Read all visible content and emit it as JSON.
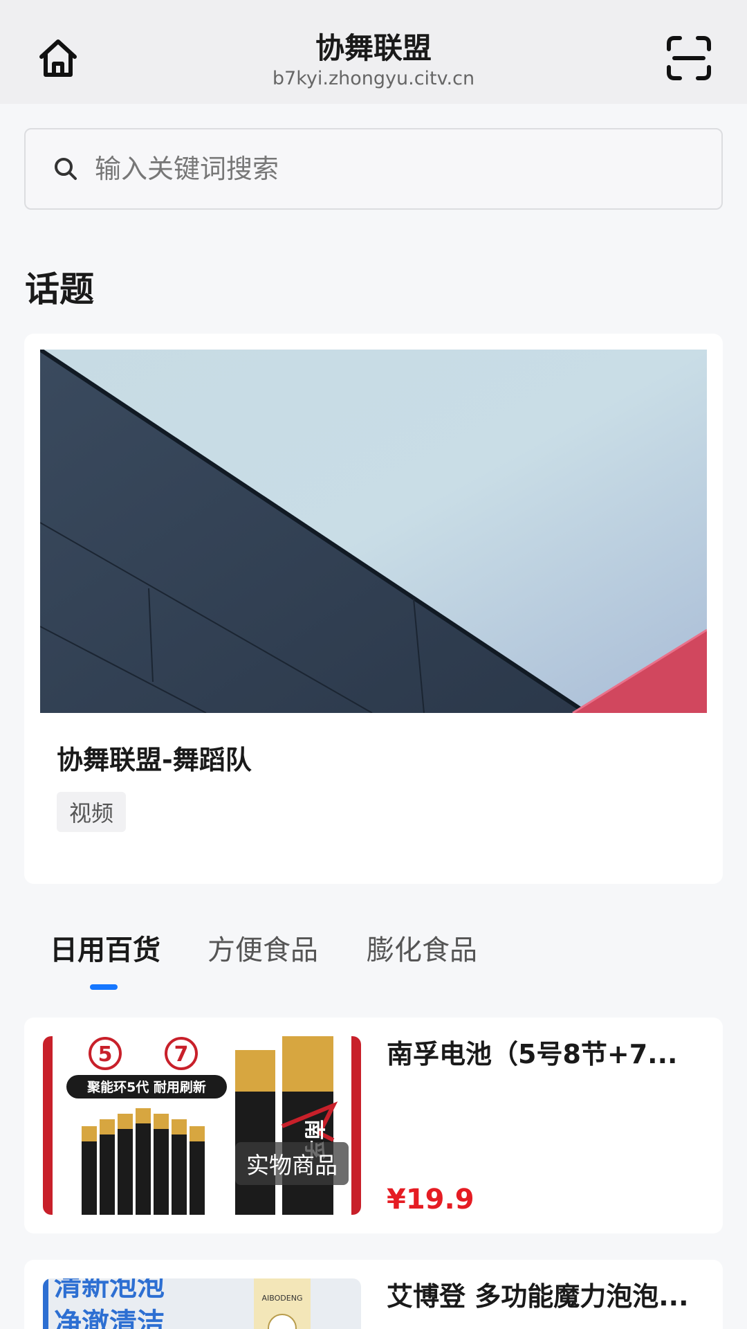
{
  "header": {
    "title": "协舞联盟",
    "url": "b7kyi.zhongyu.citv.cn",
    "home_icon": "home-icon",
    "scan_icon": "scan-icon"
  },
  "search": {
    "placeholder": "输入关键词搜索",
    "icon": "search-icon"
  },
  "topics": {
    "section_title": "话题",
    "card": {
      "title": "协舞联盟-舞蹈队",
      "tag": "视频"
    }
  },
  "tabs": [
    {
      "label": "日用百货",
      "active": true
    },
    {
      "label": "方便食品",
      "active": false
    },
    {
      "label": "膨化食品",
      "active": false
    }
  ],
  "products": [
    {
      "name": "南孚电池（5号8节+7...",
      "price": "¥19.9",
      "badge": "实物商品",
      "thumb_text": {
        "n5": "5",
        "n7": "7",
        "slogan": "聚能环5代 耐用刷新",
        "brand": "南孚"
      }
    },
    {
      "name": "艾博登 多功能魔力泡泡...",
      "thumb_text": {
        "line1": "清新泡泡",
        "line2": "净澈清洁",
        "brand": "AIBODENG"
      }
    }
  ],
  "colors": {
    "accent": "#1677ff",
    "price": "#e51c23",
    "header_bg": "#efeff1"
  }
}
